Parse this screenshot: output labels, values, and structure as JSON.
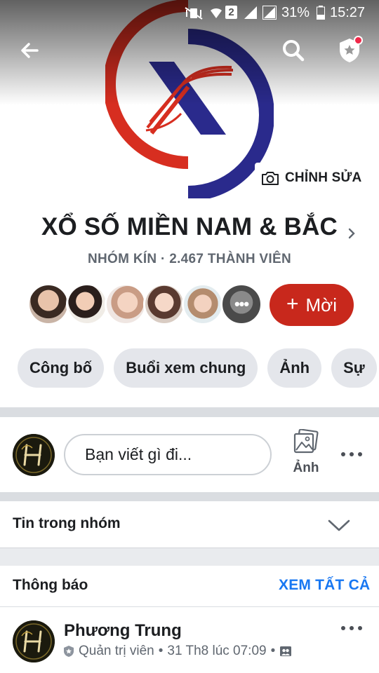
{
  "status_bar": {
    "signal_sim": "2",
    "battery_percent": "31%",
    "time": "15:27"
  },
  "cover": {
    "edit_label": "CHỈNH SỬA",
    "logo_letter": "X"
  },
  "group": {
    "name": "XỔ SỐ MIỀN NAM & BẮC",
    "subtitle": "NHÓM KÍN · 2.467 THÀNH VIÊN"
  },
  "members": {
    "more_label": "•••"
  },
  "invite": {
    "plus": "+",
    "label": "Mời"
  },
  "tabs": [
    {
      "label": "Công bố"
    },
    {
      "label": "Buổi xem chung"
    },
    {
      "label": "Ảnh"
    },
    {
      "label": "Sự"
    }
  ],
  "composer": {
    "placeholder": "Bạn viết gì đi...",
    "photo_label": "Ảnh"
  },
  "feed": {
    "group_posts_label": "Tin trong nhóm"
  },
  "announcements": {
    "title": "Thông báo",
    "see_all": "XEM TẤT CẢ"
  },
  "post": {
    "author": "Phương Trung",
    "role": "Quản trị viên",
    "separator": "•",
    "timestamp": "31 Th8 lúc 07:09",
    "separator2": "•"
  },
  "colors": {
    "accent_blue": "#1877f2",
    "invite_red": "#c8281c",
    "logo_red": "#d72e20",
    "logo_navy": "#2a2a8c"
  }
}
